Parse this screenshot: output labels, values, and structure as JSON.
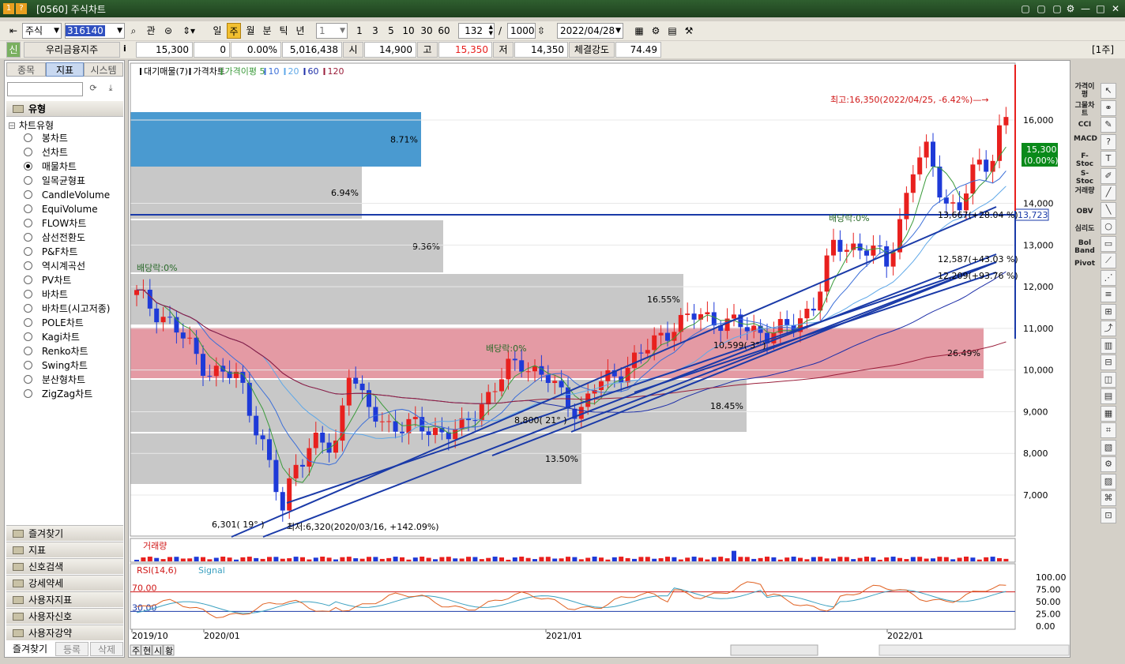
{
  "window": {
    "code": "[0560]",
    "title": "주식차트",
    "win_buttons": [
      "▢",
      "▢",
      "▢",
      "⚙",
      "—",
      "□",
      "✕"
    ]
  },
  "toolbar": {
    "market_select": "주식",
    "stock_code": "316140",
    "btn_gwan": "관",
    "periods": [
      "일",
      "주",
      "월",
      "분",
      "틱",
      "년"
    ],
    "active_period": "주",
    "interval_select": "1",
    "quick_intervals": [
      "1",
      "3",
      "5",
      "10",
      "30",
      "60"
    ],
    "count_value": "132",
    "slash": "/",
    "total_count": "1000",
    "date_value": "2022/04/28"
  },
  "infobar": {
    "flag": "신",
    "stock_name": "우리금융지주",
    "info_icon": "i",
    "price": "15,300",
    "change": "0",
    "change_pct": "0.00%",
    "volume": "5,016,438",
    "open_label": "시",
    "open": "14,900",
    "high_label": "고",
    "high": "15,350",
    "low_label": "저",
    "low": "14,350",
    "strength_label": "체결강도",
    "strength": "74.49",
    "period_badge": "[1주]"
  },
  "left_panel": {
    "tabs": [
      "종목",
      "지표",
      "시스템"
    ],
    "active_tab": "지표",
    "search_placeholder": "",
    "section": "유형",
    "group": "차트유형",
    "items": [
      "봉차트",
      "선차트",
      "매물차트",
      "일목균형표",
      "CandleVolume",
      "EquiVolume",
      "FLOW차트",
      "삼선전환도",
      "P&F차트",
      "역시계곡선",
      "PV차트",
      "바차트",
      "바차트(시고저종)",
      "POLE차트",
      "Kagi차트",
      "Renko차트",
      "Swing차트",
      "분산형차트",
      "ZigZag차트"
    ],
    "selected_item": "매물차트",
    "bottom_menu": [
      "즐겨찾기",
      "지표",
      "신호검색",
      "강세약세",
      "사용자지표",
      "사용자신호",
      "사용자강약"
    ],
    "footer_buttons": [
      "즐겨찾기",
      "등록",
      "삭제"
    ]
  },
  "chart": {
    "legend": [
      {
        "text": "대기매물(7)",
        "color": "#000000"
      },
      {
        "text": "가격차트",
        "color": "#000000"
      },
      {
        "text": "가격이평 5",
        "color": "#3a9a3a"
      },
      {
        "text": "10",
        "color": "#3c6fd8"
      },
      {
        "text": "20",
        "color": "#5fa8e8"
      },
      {
        "text": "60",
        "color": "#1e2fa8"
      },
      {
        "text": "120",
        "color": "#9a1e3a"
      }
    ],
    "y_ticks": [
      "16,000",
      "14,000",
      "13,000",
      "12,000",
      "11,000",
      "10,000",
      "9,000",
      "8,000",
      "7,000"
    ],
    "current_price": "15,300",
    "current_pct": "(0.00%)",
    "line_price": "13,723",
    "annotations": {
      "high": "최고:16,350(2022/04/25, -6.42%)",
      "low": "최저:6,320(2020/03/16, +142.09%)",
      "div1": "배당락:0%",
      "div2": "배당락:0%",
      "div3": "배당락:0%",
      "l1": "13,667(+28.04 %)",
      "l2": "12,587(+43.03 %)",
      "l3": "12,209(+93.76 %)",
      "l4": "10,599( 3° )",
      "l5": "8,800( 21° )",
      "l6": "6,301( 19° )"
    },
    "volume_profile": [
      {
        "pct": "8.71%",
        "highlight": "current"
      },
      {
        "pct": "6.94%",
        "highlight": ""
      },
      {
        "pct": "9.36%",
        "highlight": ""
      },
      {
        "pct": "16.55%",
        "highlight": ""
      },
      {
        "pct": "26.49%",
        "highlight": "max"
      },
      {
        "pct": "18.45%",
        "highlight": ""
      },
      {
        "pct": "13.50%",
        "highlight": ""
      }
    ],
    "volume_title": "거래량",
    "rsi_title": "RSI(14,6)",
    "rsi_signal": "Signal",
    "rsi_levels": [
      "70.00",
      "30.00"
    ],
    "rsi_ticks": [
      "100.00",
      "75.00",
      "50.00",
      "25.00",
      "0.00"
    ],
    "x_ticks": [
      "2019/10",
      "2020/01",
      "2021/01",
      "2022/01"
    ],
    "bottom_tabs": [
      "주",
      "현",
      "시",
      "황"
    ],
    "colors": {
      "up": "#e8201e",
      "down": "#1e3ad8",
      "accent": "#2aa02a"
    }
  },
  "chart_data": {
    "type": "candlestick",
    "title": "",
    "x": [
      "2019/10",
      "2020/01",
      "2021/01",
      "2022/01"
    ],
    "ylim": [
      6500,
      16500
    ],
    "high": 16350,
    "low": 6320,
    "last": 15300
  },
  "right_labels": [
    "가격이평",
    "그물차트",
    "CCI",
    "MACD",
    "F-Stoc",
    "S-Stoc",
    "거래량",
    "OBV",
    "심리도",
    "Bol Band",
    "Pivot"
  ]
}
